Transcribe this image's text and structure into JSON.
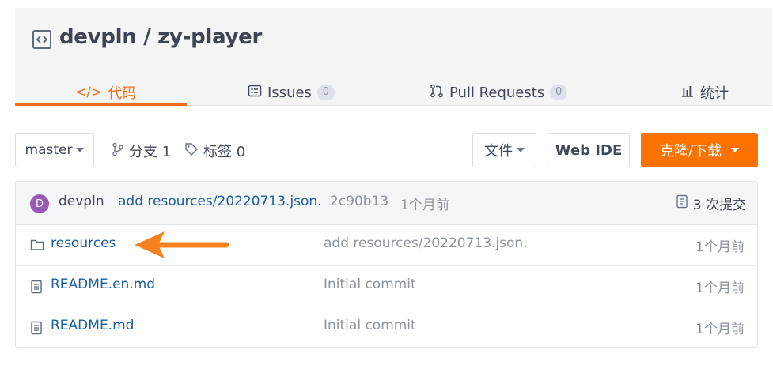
{
  "repo": {
    "owner": "devpln",
    "separator": "/",
    "name": "zy-player"
  },
  "tabs": [
    {
      "label": "代码",
      "icon": "code-icon",
      "active": true
    },
    {
      "label": "Issues",
      "icon": "issues-icon",
      "count": "0"
    },
    {
      "label": "Pull Requests",
      "icon": "pull-request-icon",
      "count": "0"
    },
    {
      "label": "统计",
      "icon": "bar-chart-icon"
    }
  ],
  "toolbar": {
    "branch": "master",
    "branches_label": "分支 1",
    "tags_label": "标签 0",
    "file_button": "文件",
    "webide_button": "Web IDE",
    "clone_button": "克隆/下载"
  },
  "commit": {
    "avatar_letter": "D",
    "author": "devpln",
    "message": "add resources/20220713.json.",
    "hash": "2c90b13",
    "time": "1个月前",
    "total_commits": "3 次提交"
  },
  "files": [
    {
      "type": "folder",
      "icon": "folder-icon",
      "name": "resources",
      "message": "add resources/20220713.json.",
      "time": "1个月前"
    },
    {
      "type": "file",
      "icon": "file-icon",
      "name": "README.en.md",
      "message": "Initial commit",
      "time": "1个月前"
    },
    {
      "type": "file",
      "icon": "file-icon",
      "name": "README.md",
      "message": "Initial commit",
      "time": "1个月前"
    }
  ],
  "colors": {
    "accent": "#f86d1b",
    "primary_button": "#fe7300",
    "link": "#1d5ea3",
    "avatar": "#9b59b6"
  }
}
